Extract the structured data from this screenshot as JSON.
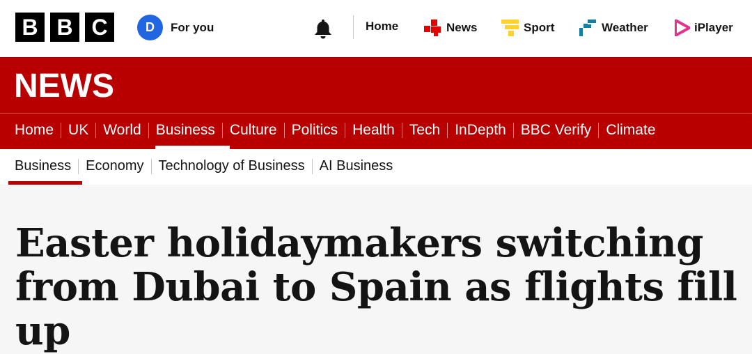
{
  "brand": {
    "letters": [
      "B",
      "B",
      "C"
    ]
  },
  "account": {
    "initial": "D",
    "label": "For you"
  },
  "top_nav": {
    "items": [
      {
        "label": "Home",
        "icon": "none"
      },
      {
        "label": "News",
        "icon": "news-icon",
        "color": "#e40000"
      },
      {
        "label": "Sport",
        "icon": "sport-icon",
        "color": "#ffd230"
      },
      {
        "label": "Weather",
        "icon": "weather-icon",
        "color": "#1380a1"
      },
      {
        "label": "iPlayer",
        "icon": "iplayer-icon",
        "color": "#e1338c"
      }
    ]
  },
  "news_banner": {
    "title": "NEWS",
    "color": "#b80000"
  },
  "section_nav": {
    "items": [
      "Home",
      "UK",
      "World",
      "Business",
      "Culture",
      "Politics",
      "Health",
      "Tech",
      "InDepth",
      "BBC Verify",
      "Climate"
    ],
    "active": "Business"
  },
  "sub_nav": {
    "items": [
      "Business",
      "Economy",
      "Technology of Business",
      "AI Business"
    ],
    "active": "Business"
  },
  "article": {
    "headline": "Easter holidaymakers switching from Dubai to Spain as flights fill up"
  }
}
